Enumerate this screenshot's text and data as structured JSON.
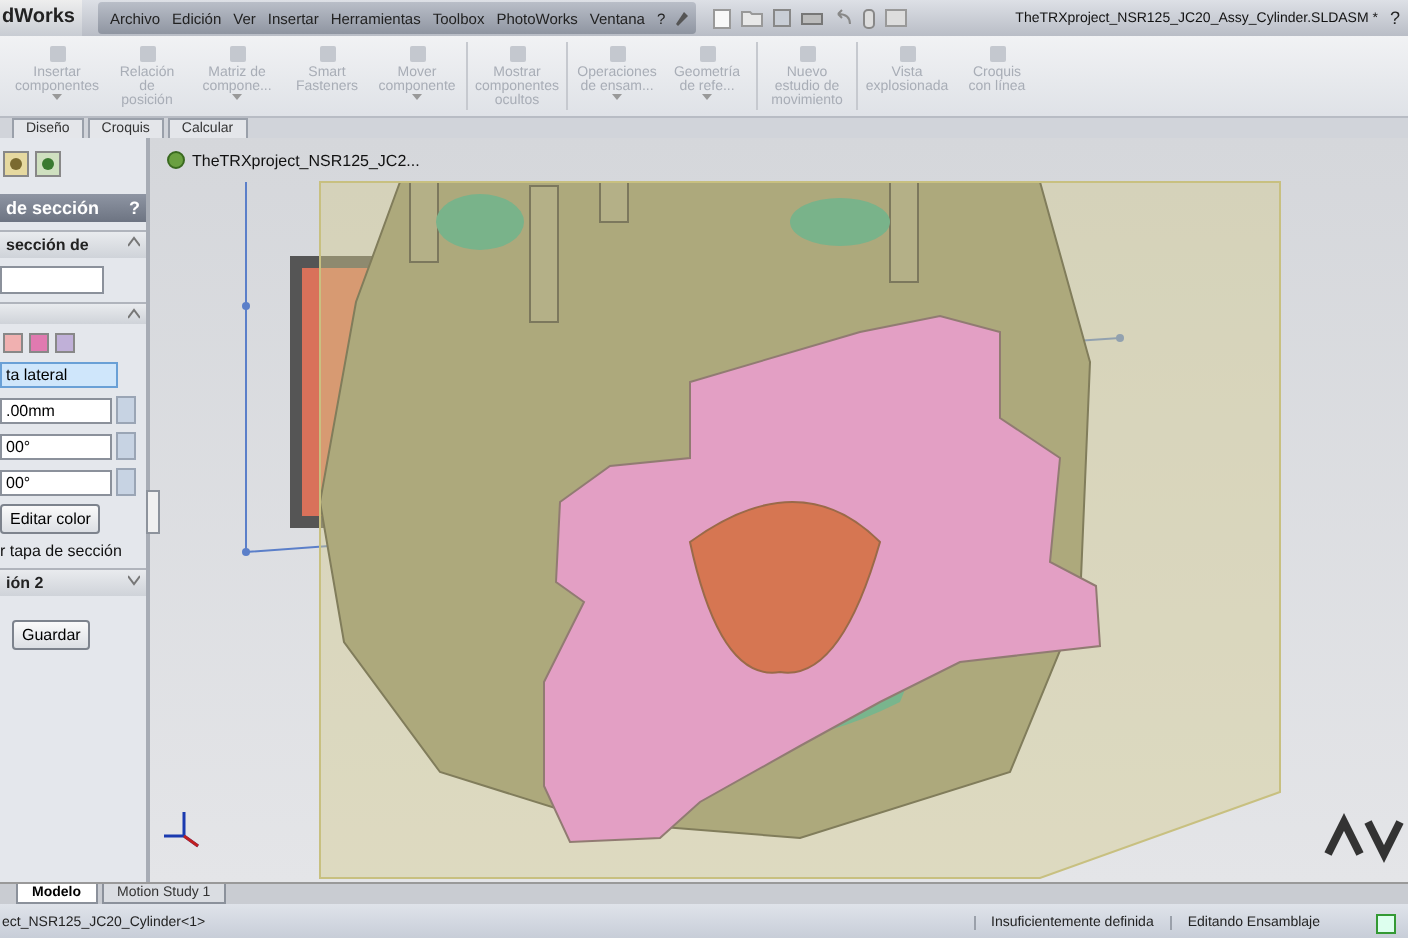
{
  "app": {
    "logo": "dWorks",
    "title": "TheTRXproject_NSR125_JC20_Assy_Cylinder.SLDASM *",
    "help": "?"
  },
  "menu": [
    "Archivo",
    "Edición",
    "Ver",
    "Insertar",
    "Herramientas",
    "Toolbox",
    "PhotoWorks",
    "Ventana",
    "?"
  ],
  "ribbon": [
    {
      "label": "Insertar componentes",
      "dropdown": true,
      "disabled": true
    },
    {
      "label": "Relación de posición",
      "dropdown": false,
      "disabled": true
    },
    {
      "label": "Matriz de compone...",
      "dropdown": true,
      "disabled": true
    },
    {
      "label": "Smart Fasteners",
      "dropdown": false,
      "disabled": true
    },
    {
      "label": "Mover componente",
      "dropdown": true,
      "disabled": true
    },
    {
      "label": "Mostrar componentes ocultos",
      "dropdown": false,
      "disabled": true
    },
    {
      "label": "Operaciones de ensam...",
      "dropdown": true,
      "disabled": true
    },
    {
      "label": "Geometría de refe...",
      "dropdown": true,
      "disabled": true
    },
    {
      "label": "Nuevo estudio de movimiento",
      "dropdown": false,
      "disabled": true
    },
    {
      "label": "Vista explosionada",
      "dropdown": false,
      "disabled": true
    },
    {
      "label": "Croquis con línea",
      "dropdown": false,
      "disabled": true
    }
  ],
  "command_tabs": [
    {
      "label": "Diseño",
      "selected": false
    },
    {
      "label": "Croquis",
      "selected": false
    },
    {
      "label": "Calcular",
      "selected": false
    }
  ],
  "panel": {
    "title": "de sección",
    "help": "?",
    "group_1": "sección de",
    "face": "ta lateral",
    "spins": [
      ".00mm",
      "00°",
      "00°"
    ],
    "edit_color": "Editar color",
    "cap_option": "r tapa de sección",
    "group_2": "ión 2",
    "save": "Guardar"
  },
  "tree": {
    "root": "TheTRXproject_NSR125_JC2..."
  },
  "bottom_tabs": [
    {
      "label": "Modelo",
      "selected": true
    },
    {
      "label": "Motion Study 1",
      "selected": false
    }
  ],
  "status_bar": {
    "component": "ect_NSR125_JC20_Cylinder<1>",
    "definition": "Insuficientemente definida",
    "mode": "Editando Ensamblaje"
  }
}
